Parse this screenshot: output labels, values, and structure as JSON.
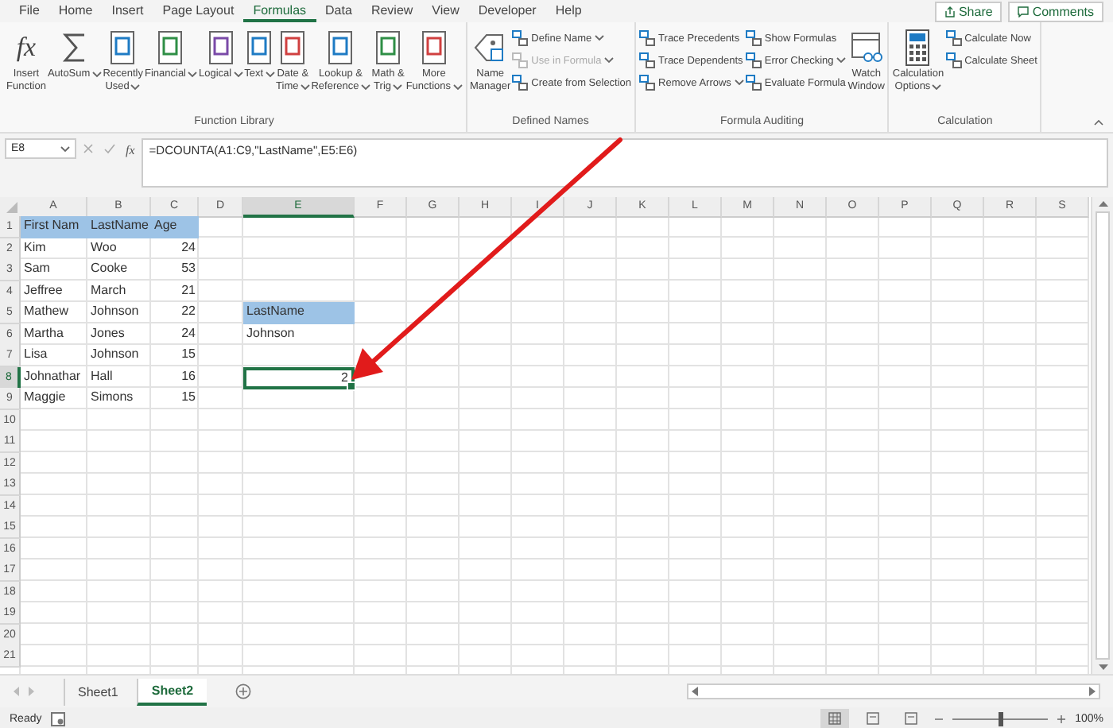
{
  "menu": {
    "tabs": [
      {
        "label": "File",
        "selected": false
      },
      {
        "label": "Home",
        "selected": false
      },
      {
        "label": "Insert",
        "selected": false
      },
      {
        "label": "Page Layout",
        "selected": false
      },
      {
        "label": "Formulas",
        "selected": true
      },
      {
        "label": "Data",
        "selected": false
      },
      {
        "label": "Review",
        "selected": false
      },
      {
        "label": "View",
        "selected": false
      },
      {
        "label": "Developer",
        "selected": false
      },
      {
        "label": "Help",
        "selected": false
      }
    ],
    "share": "Share",
    "comments": "Comments"
  },
  "ribbon": {
    "groups": [
      {
        "label": "Function Library",
        "items": [
          {
            "kind": "large",
            "icon_text": "fx",
            "lines": [
              "Insert",
              "Function"
            ],
            "dropdown": false
          },
          {
            "kind": "large",
            "lines": [
              "AutoSum"
            ],
            "dropdown": true
          },
          {
            "kind": "large",
            "lines": [
              "Recently",
              "Used"
            ],
            "dropdown": true
          },
          {
            "kind": "large",
            "lines": [
              "Financial"
            ],
            "dropdown": true
          },
          {
            "kind": "large",
            "lines": [
              "Logical"
            ],
            "dropdown": true
          },
          {
            "kind": "large",
            "lines": [
              "Text"
            ],
            "dropdown": true
          },
          {
            "kind": "large",
            "lines": [
              "Date &",
              "Time"
            ],
            "dropdown": true
          },
          {
            "kind": "large",
            "lines": [
              "Lookup &",
              "Reference"
            ],
            "dropdown": true
          },
          {
            "kind": "large",
            "lines": [
              "Math &",
              "Trig"
            ],
            "dropdown": true
          },
          {
            "kind": "large",
            "lines": [
              "More",
              "Functions"
            ],
            "dropdown": true
          }
        ]
      },
      {
        "label": "Defined Names",
        "items": [
          {
            "kind": "large",
            "lines": [
              "Name",
              "Manager"
            ],
            "dropdown": false
          },
          {
            "kind": "stack",
            "items": [
              {
                "label": "Define Name",
                "dropdown": true,
                "disabled": false
              },
              {
                "label": "Use in Formula",
                "dropdown": true,
                "disabled": true
              },
              {
                "label": "Create from Selection",
                "dropdown": false,
                "disabled": false
              }
            ]
          }
        ]
      },
      {
        "label": "Formula Auditing",
        "items": [
          {
            "kind": "stack",
            "items": [
              {
                "label": "Trace Precedents",
                "dropdown": false,
                "disabled": false
              },
              {
                "label": "Trace Dependents",
                "dropdown": false,
                "disabled": false
              },
              {
                "label": "Remove Arrows",
                "dropdown": true,
                "disabled": false
              }
            ]
          },
          {
            "kind": "stack",
            "items": [
              {
                "label": "Show Formulas",
                "dropdown": false,
                "disabled": false
              },
              {
                "label": "Error Checking",
                "dropdown": true,
                "disabled": false
              },
              {
                "label": "Evaluate Formula",
                "dropdown": false,
                "disabled": false
              }
            ]
          },
          {
            "kind": "large",
            "lines": [
              "Watch",
              "Window"
            ],
            "dropdown": false
          }
        ]
      },
      {
        "label": "Calculation",
        "items": [
          {
            "kind": "large",
            "lines": [
              "Calculation",
              "Options"
            ],
            "dropdown": true
          },
          {
            "kind": "stack",
            "items": [
              {
                "label": "Calculate Now",
                "dropdown": false,
                "disabled": false
              },
              {
                "label": "Calculate Sheet",
                "dropdown": false,
                "disabled": false
              }
            ]
          }
        ]
      }
    ]
  },
  "formula_bar": {
    "name_box": "E8",
    "function_label": "fx",
    "formula": "=DCOUNTA(A1:C9,\"LastName\",E5:E6)"
  },
  "sheet": {
    "columns": [
      {
        "label": "A",
        "selected": false
      },
      {
        "label": "B",
        "selected": false
      },
      {
        "label": "C",
        "selected": false
      },
      {
        "label": "D",
        "selected": false
      },
      {
        "label": "E",
        "selected": true
      },
      {
        "label": "F",
        "selected": false
      },
      {
        "label": "G",
        "selected": false
      },
      {
        "label": "H",
        "selected": false
      },
      {
        "label": "I",
        "selected": false
      },
      {
        "label": "J",
        "selected": false
      },
      {
        "label": "K",
        "selected": false
      },
      {
        "label": "L",
        "selected": false
      },
      {
        "label": "M",
        "selected": false
      },
      {
        "label": "N",
        "selected": false
      },
      {
        "label": "O",
        "selected": false
      },
      {
        "label": "P",
        "selected": false
      },
      {
        "label": "Q",
        "selected": false
      },
      {
        "label": "R",
        "selected": false
      },
      {
        "label": "S",
        "selected": false
      }
    ],
    "rows": [
      {
        "number": "1",
        "selected": false,
        "cells": {
          "a": {
            "text": "First Nam",
            "kind": "text",
            "filled": true,
            "selected": false
          },
          "b": {
            "text": "LastName",
            "kind": "text",
            "filled": true,
            "selected": false
          },
          "c": {
            "text": "Age",
            "kind": "text",
            "filled": true,
            "selected": false
          }
        }
      },
      {
        "number": "2",
        "selected": false,
        "cells": {
          "a": {
            "text": "Kim",
            "kind": "text",
            "filled": false,
            "selected": false
          },
          "b": {
            "text": "Woo",
            "kind": "text",
            "filled": false,
            "selected": false
          },
          "c": {
            "text": "24",
            "kind": "number",
            "filled": false,
            "selected": false
          }
        }
      },
      {
        "number": "3",
        "selected": false,
        "cells": {
          "a": {
            "text": "Sam",
            "kind": "text",
            "filled": false,
            "selected": false
          },
          "b": {
            "text": "Cooke",
            "kind": "text",
            "filled": false,
            "selected": false
          },
          "c": {
            "text": "53",
            "kind": "number",
            "filled": false,
            "selected": false
          }
        }
      },
      {
        "number": "4",
        "selected": false,
        "cells": {
          "a": {
            "text": "Jeffree",
            "kind": "text",
            "filled": false,
            "selected": false
          },
          "b": {
            "text": "March",
            "kind": "text",
            "filled": false,
            "selected": false
          },
          "c": {
            "text": "21",
            "kind": "number",
            "filled": false,
            "selected": false
          }
        }
      },
      {
        "number": "5",
        "selected": false,
        "cells": {
          "a": {
            "text": "Mathew",
            "kind": "text",
            "filled": false,
            "selected": false
          },
          "b": {
            "text": "Johnson",
            "kind": "text",
            "filled": false,
            "selected": false
          },
          "c": {
            "text": "22",
            "kind": "number",
            "filled": false,
            "selected": false
          },
          "e": {
            "text": "LastName",
            "kind": "text",
            "filled": true,
            "selected": false
          }
        }
      },
      {
        "number": "6",
        "selected": false,
        "cells": {
          "a": {
            "text": "Martha",
            "kind": "text",
            "filled": false,
            "selected": false
          },
          "b": {
            "text": "Jones",
            "kind": "text",
            "filled": false,
            "selected": false
          },
          "c": {
            "text": "24",
            "kind": "number",
            "filled": false,
            "selected": false
          },
          "e": {
            "text": "Johnson",
            "kind": "text",
            "filled": false,
            "selected": false
          }
        }
      },
      {
        "number": "7",
        "selected": false,
        "cells": {
          "a": {
            "text": "Lisa",
            "kind": "text",
            "filled": false,
            "selected": false
          },
          "b": {
            "text": "Johnson",
            "kind": "text",
            "filled": false,
            "selected": false
          },
          "c": {
            "text": "15",
            "kind": "number",
            "filled": false,
            "selected": false
          }
        }
      },
      {
        "number": "8",
        "selected": true,
        "cells": {
          "a": {
            "text": "Johnathar",
            "kind": "text",
            "filled": false,
            "selected": false
          },
          "b": {
            "text": "Hall",
            "kind": "text",
            "filled": false,
            "selected": false
          },
          "c": {
            "text": "16",
            "kind": "number",
            "filled": false,
            "selected": false
          },
          "e": {
            "text": "2",
            "kind": "number",
            "filled": false,
            "selected": true
          }
        }
      },
      {
        "number": "9",
        "selected": false,
        "cells": {
          "a": {
            "text": "Maggie",
            "kind": "text",
            "filled": false,
            "selected": false
          },
          "b": {
            "text": "Simons",
            "kind": "text",
            "filled": false,
            "selected": false
          },
          "c": {
            "text": "15",
            "kind": "number",
            "filled": false,
            "selected": false
          }
        }
      },
      {
        "number": "10",
        "selected": false,
        "cells": {}
      },
      {
        "number": "11",
        "selected": false,
        "cells": {}
      },
      {
        "number": "12",
        "selected": false,
        "cells": {}
      },
      {
        "number": "13",
        "selected": false,
        "cells": {}
      },
      {
        "number": "14",
        "selected": false,
        "cells": {}
      },
      {
        "number": "15",
        "selected": false,
        "cells": {}
      },
      {
        "number": "16",
        "selected": false,
        "cells": {}
      },
      {
        "number": "17",
        "selected": false,
        "cells": {}
      },
      {
        "number": "18",
        "selected": false,
        "cells": {}
      },
      {
        "number": "19",
        "selected": false,
        "cells": {}
      },
      {
        "number": "20",
        "selected": false,
        "cells": {}
      },
      {
        "number": "21",
        "selected": false,
        "cells": {}
      }
    ]
  },
  "sheet_tabs": [
    {
      "label": "Sheet1",
      "selected": false
    },
    {
      "label": "Sheet2",
      "selected": true
    }
  ],
  "status_bar": {
    "status": "Ready",
    "views": [
      {
        "selected": true
      },
      {
        "selected": false
      },
      {
        "selected": false
      }
    ],
    "zoom": {
      "level": 0.5,
      "reading": "100%"
    }
  }
}
